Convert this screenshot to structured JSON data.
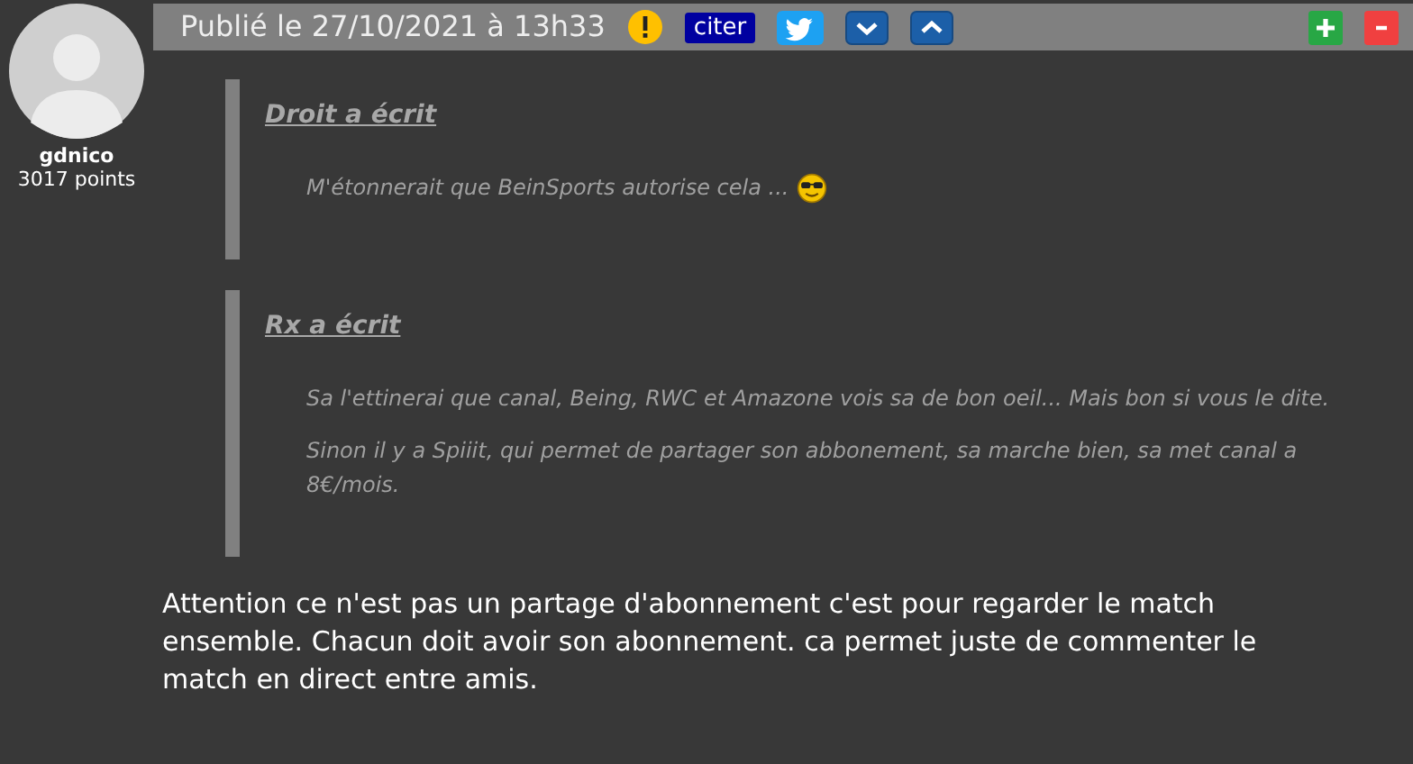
{
  "author": {
    "name": "gdnico",
    "points": "3017 points"
  },
  "header": {
    "published": "Publié le 27/10/2021 à 13h33",
    "quote_button": "citer"
  },
  "quotes": [
    {
      "author": "Droit a écrit",
      "paragraphs": [
        {
          "text": "M'étonnerait que BeinSports autorise cela ...",
          "smiley": true
        }
      ]
    },
    {
      "author": "Rx a écrit",
      "paragraphs": [
        {
          "text": "Sa l'ettinerai que canal, Being, RWC et Amazone vois sa de bon oeil... Mais bon si vous le dite.",
          "smiley": false
        },
        {
          "text": "Sinon il y a Spiiit, qui permet de partager son abbonement, sa marche bien, sa met canal a 8€/mois.",
          "smiley": false
        }
      ]
    }
  ],
  "message": "Attention ce n'est pas un partage d'abonnement c'est pour regarder le match ensemble. Chacun doit avoir son abonnement. ca permet juste de commenter le match en direct entre amis."
}
